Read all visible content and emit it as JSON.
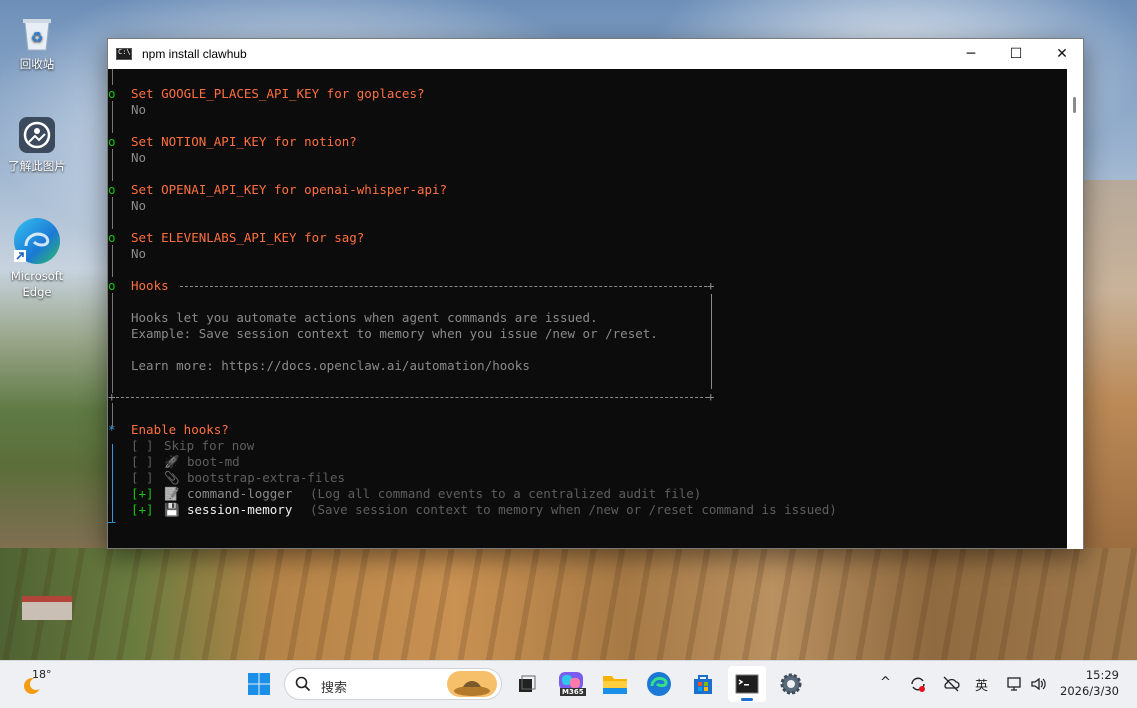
{
  "desktop": {
    "icons": [
      {
        "label": "回收站",
        "icon": "recycle-bin-icon"
      },
      {
        "label": "了解此图片",
        "icon": "learn-picture-icon"
      },
      {
        "label": "Microsoft Edge",
        "icon": "edge-icon"
      }
    ]
  },
  "window": {
    "title": "npm install clawhub",
    "buttons": {
      "minimize": "─",
      "maximize": "☐",
      "close": "✕"
    }
  },
  "terminal": {
    "bullet": "o",
    "prompts": [
      {
        "question": "Set GOOGLE_PLACES_API_KEY for goplaces?",
        "answer": "No"
      },
      {
        "question": "Set NOTION_API_KEY for notion?",
        "answer": "No"
      },
      {
        "question": "Set OPENAI_API_KEY for openai-whisper-api?",
        "answer": "No"
      },
      {
        "question": "Set ELEVENLABS_API_KEY for sag?",
        "answer": "No"
      }
    ],
    "hooks": {
      "title": "Hooks",
      "line1": "Hooks let you automate actions when agent commands are issued.",
      "line2": "Example: Save session context to memory when you issue /new or /reset.",
      "line3": "Learn more: https://docs.openclaw.ai/automation/hooks"
    },
    "enable": {
      "marker": "*",
      "question": "Enable hooks?",
      "options": [
        {
          "box": "[ ]",
          "icon": "",
          "label": "Skip for now",
          "desc": ""
        },
        {
          "box": "[ ]",
          "icon": "🚀",
          "label": "boot-md",
          "desc": ""
        },
        {
          "box": "[ ]",
          "icon": "📎",
          "label": "bootstrap-extra-files",
          "desc": ""
        },
        {
          "box": "[+]",
          "icon": "📝",
          "label": "command-logger",
          "desc": "(Log all command events to a centralized audit file)"
        },
        {
          "box": "[+]",
          "icon": "💾",
          "label": "session-memory",
          "desc": "(Save session context to memory when /new or /reset command is issued)"
        }
      ]
    },
    "cursor": "—"
  },
  "taskbar": {
    "weather": {
      "temp": "18°"
    },
    "search_placeholder": "搜索",
    "apps": [
      "start-icon",
      "search",
      "task-view-icon",
      "m365-icon",
      "file-explorer-icon",
      "edge-icon",
      "store-icon",
      "terminal-icon",
      "settings-icon"
    ],
    "m365_label": "M365",
    "tray": {
      "chevron": "^",
      "ime": "英"
    },
    "time": "15:29",
    "date": "2026/3/30"
  }
}
